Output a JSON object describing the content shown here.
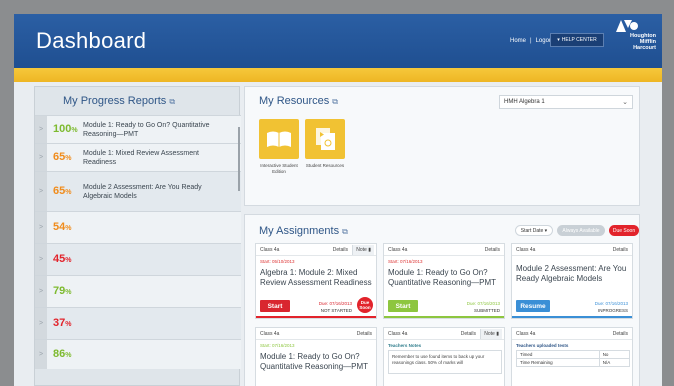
{
  "header": {
    "title": "Dashboard",
    "home_label": "Home",
    "separator": "|",
    "logout_label": "Logout",
    "help_label": "HELP CENTER",
    "logo_text": [
      "Houghton",
      "Mifflin",
      "Harcourt"
    ]
  },
  "progress": {
    "title": "My Progress Reports",
    "items": [
      {
        "pct": "100",
        "name": "Module 1: Ready to Go On? Quantitative Reasoning—PMT",
        "color": "#7dba2f"
      },
      {
        "pct": "65",
        "name": "Module 1: Mixed Review Assessment Readiness",
        "color": "#f08c1c"
      },
      {
        "pct": "65",
        "name": "Module 2 Assessment: Are You Ready Algebraic Models",
        "color": "#f08c1c"
      },
      {
        "pct": "54",
        "name": "",
        "color": "#f08c1c"
      },
      {
        "pct": "45",
        "name": "",
        "color": "#e2232b"
      },
      {
        "pct": "79",
        "name": "",
        "color": "#7dba2f"
      },
      {
        "pct": "37",
        "name": "",
        "color": "#e2232b"
      },
      {
        "pct": "86",
        "name": "",
        "color": "#7dba2f"
      }
    ],
    "pct_suffix": "%",
    "chevron": ">"
  },
  "resources": {
    "title": "My Resources",
    "selected": "HMH Algebra 1",
    "tiles": [
      {
        "label": "Interactive Student Edition",
        "icon": "book-icon"
      },
      {
        "label": "Student Resources",
        "icon": "documents-icon"
      }
    ]
  },
  "assignments": {
    "title": "My Assignments",
    "filters": {
      "start_date": "Start Date",
      "always_available": "Always Available",
      "due_soon": "Due Soon"
    },
    "cards": [
      {
        "class": "Class 4a",
        "details": "Details",
        "note": "Note",
        "start": "Start: 05/10/2013",
        "title": "Algebra 1: Module 2: Mixed Review Assessment Readiness",
        "button": "Start",
        "due": "Due: 07/16/2013",
        "status": "NOT STARTED",
        "soon": "Due Soon",
        "accent": "#e2232b"
      },
      {
        "class": "Class 4a",
        "details": "Details",
        "start": "Start: 07/16/2013",
        "title": "Module 1: Ready to Go On? Quantitative Reasoning—PMT",
        "button": "Start",
        "due": "Due: 07/16/2013",
        "status": "SUBMITTED",
        "accent": "#8dc63f"
      },
      {
        "class": "Class 4a",
        "details": "Details",
        "title": "Module 2 Assessment: Are You Ready Algebraic Models",
        "button": "Resume",
        "due": "Due: 07/16/2013",
        "status": "INPROGRESS",
        "accent": "#3a8fd6"
      },
      {
        "class": "Class 4a",
        "details": "Details",
        "start": "Start: 07/16/2013",
        "title": "Module 1: Ready to Go On? Quantitative Reasoning—PMT"
      },
      {
        "class": "Class 4a",
        "details": "Details",
        "note": "Note",
        "notes_title": "Teachers Notes",
        "notes_body": "Remember to use found items to back up your reasonings class. 50% of marks will"
      },
      {
        "class": "Class 4a",
        "details": "Details",
        "tests_title": "Teachers uploaded tests",
        "rows": [
          {
            "k": "Timed",
            "v": "No"
          },
          {
            "k": "Time Remaining",
            "v": "N/A"
          }
        ]
      }
    ]
  }
}
